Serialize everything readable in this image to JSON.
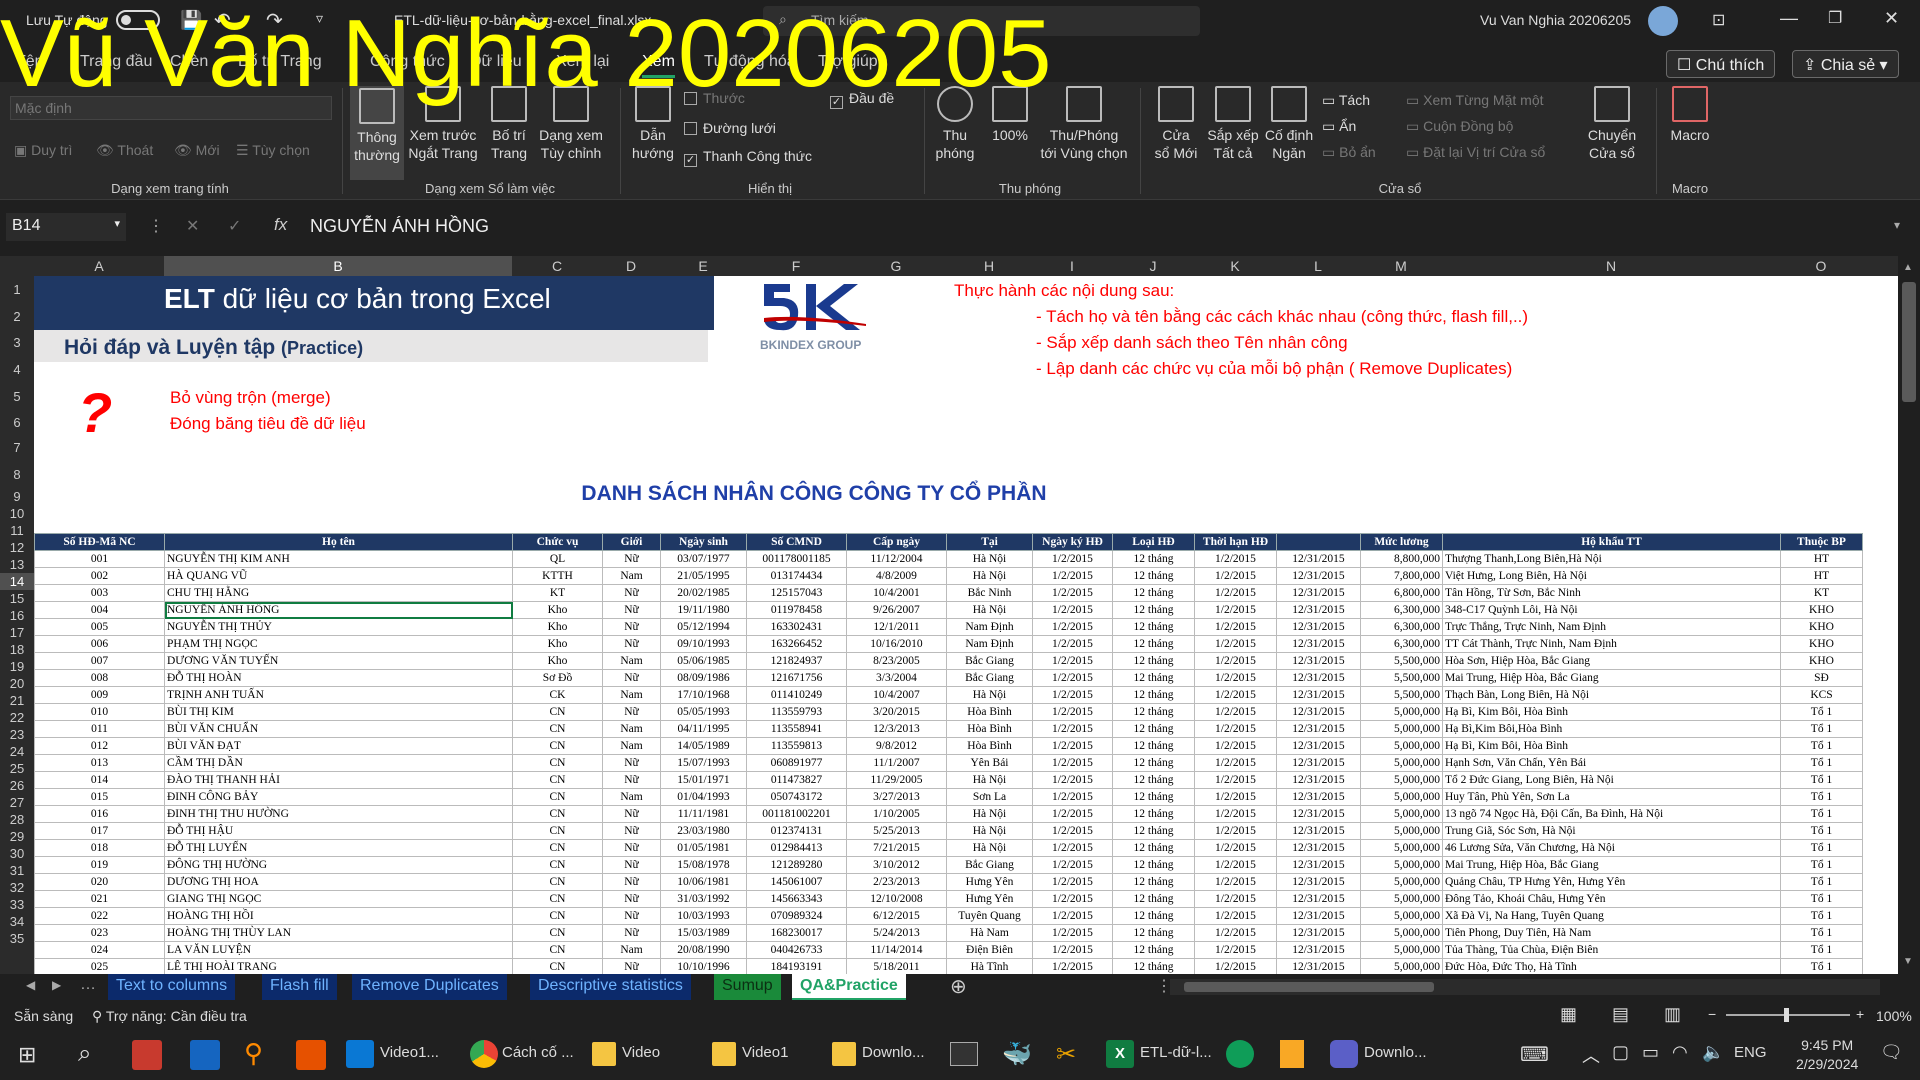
{
  "watermark": "Vũ Văn Nghĩa 20206205",
  "titlebar": {
    "autosave_label": "Lưu Tự động",
    "filename": "ETL-dữ-liệu-cơ-bản-bằng-excel_final.xlsx",
    "search_placeholder": "Tìm kiếm",
    "user": "Vu Van Nghia 20206205"
  },
  "tabs": [
    "Tệp",
    "Trang đầu",
    "Chèn",
    "Bố trí Trang",
    "Công thức",
    "Dữ liệu",
    "Xem lại",
    "Xem",
    "Tự động hóa",
    "Trợ giúp"
  ],
  "comment_btn": "Chú thích",
  "share_btn": "Chia sẻ",
  "ribbon": {
    "sheetview_select": "Mặc định",
    "sheetview_btns": [
      "Duy trì",
      "Thoát",
      "Mới",
      "Tùy chọn"
    ],
    "sheetview_label": "Dạng xem trang tính",
    "workbook_views": [
      {
        "l1": "Thông",
        "l2": "thường"
      },
      {
        "l1": "Xem trước",
        "l2": "Ngắt Trang"
      },
      {
        "l1": "Bố trí",
        "l2": "Trang"
      },
      {
        "l1": "Dạng xem",
        "l2": "Tùy chỉnh"
      }
    ],
    "workbook_label": "Dạng xem Sổ làm việc",
    "show_nav": {
      "l1": "Dẫn",
      "l2": "hướng"
    },
    "show_items": [
      {
        "label": "Thước",
        "checked": "",
        "enabled": false
      },
      {
        "label": "Đường lưới",
        "checked": "",
        "enabled": true
      },
      {
        "label": "Thanh Công thức",
        "checked": "✓",
        "enabled": true
      },
      {
        "label": "Đầu đề",
        "checked": "✓",
        "enabled": true
      }
    ],
    "show_label": "Hiển thị",
    "zoom_btns": [
      {
        "l1": "Thu",
        "l2": "phóng"
      },
      {
        "l1": "100%",
        "l2": ""
      },
      {
        "l1": "Thu/Phóng",
        "l2": "tới Vùng chọn"
      }
    ],
    "zoom_label": "Thu phóng",
    "window_btns": [
      {
        "l1": "Cửa",
        "l2": "sổ Mới"
      },
      {
        "l1": "Sắp xếp",
        "l2": "Tất cả"
      },
      {
        "l1": "Cố định",
        "l2": "Ngăn"
      }
    ],
    "window_small": [
      "Tách",
      "Ẩn",
      "Bỏ ẩn",
      "Xem Từng Mặt một",
      "Cuộn Đồng bộ",
      "Đặt lại Vị trí Cửa sổ"
    ],
    "switch_btn": {
      "l1": "Chuyển",
      "l2": "Cửa sổ"
    },
    "window_label": "Cửa sổ",
    "macro_btn": "Macro",
    "macro_label": "Macro"
  },
  "formula": {
    "namebox": "B14",
    "fx": "fx",
    "value": "NGUYỄN ÁNH HỒNG"
  },
  "columns": [
    "A",
    "B",
    "C",
    "D",
    "E",
    "F",
    "G",
    "H",
    "I",
    "J",
    "K",
    "L",
    "M",
    "N",
    "O"
  ],
  "rows": [
    "1",
    "2",
    "3",
    "4",
    "5",
    "6",
    "7",
    "8",
    "9",
    "10",
    "11",
    "12",
    "13",
    "14",
    "15",
    "16",
    "17",
    "18",
    "19",
    "20",
    "21",
    "22",
    "23",
    "24",
    "25",
    "26",
    "27",
    "28",
    "29",
    "30",
    "31",
    "32",
    "33",
    "34",
    "35"
  ],
  "sheet": {
    "banner_title_bold": "ELT",
    "banner_title_rest": " dữ liệu cơ bản trong Excel",
    "subtitle": "Hỏi đáp và Luyện tập",
    "subtitle_paren": "(Practice)",
    "logo_sub": "BKINDEX GROUP",
    "question": "?",
    "notes": [
      "Bỏ vùng trộn (merge)",
      "Đóng băng tiêu đề dữ liệu"
    ],
    "practice_title": "Thực hành các nội dung sau:",
    "practice_items": [
      "- Tách họ và tên bằng các cách khác nhau (công thức, flash fill,..)",
      "- Sắp xếp danh sách theo Tên nhân công",
      "- Lập danh các chức vụ của mỗi bộ phận ( Remove Duplicates)"
    ],
    "list_title": "DANH SÁCH NHÂN CÔNG CÔNG TY CỔ PHẦN",
    "headers": [
      "Số HĐ-Mã NC",
      "Họ tên",
      "Chức vụ",
      "Giới",
      "Ngày sinh",
      "Số CMND",
      "Cấp ngày",
      "Tại",
      "Ngày ký HĐ",
      "Loại HĐ",
      "Thời hạn HĐ",
      "",
      "Mức lương",
      "Hộ khẩu TT",
      "Thuộc BP"
    ],
    "records": [
      [
        "001",
        "NGUYỄN THỊ KIM ANH",
        "QL",
        "Nữ",
        "03/07/1977",
        "001178001185",
        "11/12/2004",
        "Hà Nội",
        "1/2/2015",
        "12 tháng",
        "1/2/2015",
        "12/31/2015",
        "8,800,000",
        "Thượng Thanh,Long Biên,Hà Nội",
        "HT"
      ],
      [
        "002",
        "HÀ QUANG VŨ",
        "KTTH",
        "Nam",
        "21/05/1995",
        "013174434",
        "4/8/2009",
        "Hà Nội",
        "1/2/2015",
        "12 tháng",
        "1/2/2015",
        "12/31/2015",
        "7,800,000",
        "Việt Hưng, Long Biên, Hà Nội",
        "HT"
      ],
      [
        "003",
        "CHU THỊ HẰNG",
        "KT",
        "Nữ",
        "20/02/1985",
        "125157043",
        "10/4/2001",
        "Bắc Ninh",
        "1/2/2015",
        "12 tháng",
        "1/2/2015",
        "12/31/2015",
        "6,800,000",
        "Tân Hồng, Từ Sơn, Bắc Ninh",
        "KT"
      ],
      [
        "004",
        "NGUYỄN ÁNH HỒNG",
        "Kho",
        "Nữ",
        "19/11/1980",
        "011978458",
        "9/26/2007",
        "Hà Nội",
        "1/2/2015",
        "12 tháng",
        "1/2/2015",
        "12/31/2015",
        "6,300,000",
        "348-C17 Quỳnh Lôi, Hà Nội",
        "KHO"
      ],
      [
        "005",
        "NGUYỄN THỊ THỦY",
        "Kho",
        "Nữ",
        "05/12/1994",
        "163302431",
        "12/1/2011",
        "Nam Định",
        "1/2/2015",
        "12 tháng",
        "1/2/2015",
        "12/31/2015",
        "6,300,000",
        "Trực Thắng, Trực Ninh, Nam Định",
        "KHO"
      ],
      [
        "006",
        "PHẠM THỊ NGỌC",
        "Kho",
        "Nữ",
        "09/10/1993",
        "163266452",
        "10/16/2010",
        "Nam Định",
        "1/2/2015",
        "12 tháng",
        "1/2/2015",
        "12/31/2015",
        "6,300,000",
        "TT Cát Thành, Trực Ninh, Nam Định",
        "KHO"
      ],
      [
        "007",
        "DƯƠNG VĂN TUYẾN",
        "Kho",
        "Nam",
        "05/06/1985",
        "121824937",
        "8/23/2005",
        "Bắc Giang",
        "1/2/2015",
        "12 tháng",
        "1/2/2015",
        "12/31/2015",
        "5,500,000",
        "Hòa Sơn, Hiệp Hòa, Bắc Giang",
        "KHO"
      ],
      [
        "008",
        "ĐỖ THỊ HOÀN",
        "Sơ Đồ",
        "Nữ",
        "08/09/1986",
        "121671756",
        "3/3/2004",
        "Bắc Giang",
        "1/2/2015",
        "12 tháng",
        "1/2/2015",
        "12/31/2015",
        "5,500,000",
        "Mai Trung, Hiệp Hòa, Bắc Giang",
        "SĐ"
      ],
      [
        "009",
        "TRỊNH ANH TUẤN",
        "CK",
        "Nam",
        "17/10/1968",
        "011410249",
        "10/4/2007",
        "Hà Nội",
        "1/2/2015",
        "12 tháng",
        "1/2/2015",
        "12/31/2015",
        "5,500,000",
        "Thạch Bàn, Long Biên, Hà Nội",
        "KCS"
      ],
      [
        "010",
        "BÙI THỊ KIM",
        "CN",
        "Nữ",
        "05/05/1993",
        "113559793",
        "3/20/2015",
        "Hòa Bình",
        "1/2/2015",
        "12 tháng",
        "1/2/2015",
        "12/31/2015",
        "5,000,000",
        "Hạ Bì, Kim Bôi, Hòa Bình",
        "Tổ 1"
      ],
      [
        "011",
        "BÙI VĂN CHUẨN",
        "CN",
        "Nam",
        "04/11/1995",
        "113558941",
        "12/3/2013",
        "Hòa Bình",
        "1/2/2015",
        "12 tháng",
        "1/2/2015",
        "12/31/2015",
        "5,000,000",
        "Hạ Bì,Kim Bôi,Hòa Bình",
        "Tổ 1"
      ],
      [
        "012",
        "BÙI VĂN ĐẠT",
        "CN",
        "Nam",
        "14/05/1989",
        "113559813",
        "9/8/2012",
        "Hòa Bình",
        "1/2/2015",
        "12 tháng",
        "1/2/2015",
        "12/31/2015",
        "5,000,000",
        "Hạ Bì, Kim Bôi, Hòa Bình",
        "Tổ 1"
      ],
      [
        "013",
        "CẦM THỊ DẦN",
        "CN",
        "Nữ",
        "15/07/1993",
        "060891977",
        "11/1/2007",
        "Yên Bái",
        "1/2/2015",
        "12 tháng",
        "1/2/2015",
        "12/31/2015",
        "5,000,000",
        "Hạnh Sơn, Văn Chấn, Yên Bái",
        "Tổ 1"
      ],
      [
        "014",
        "ĐÀO THỊ THANH HẢI",
        "CN",
        "Nữ",
        "15/01/1971",
        "011473827",
        "11/29/2005",
        "Hà Nội",
        "1/2/2015",
        "12 tháng",
        "1/2/2015",
        "12/31/2015",
        "5,000,000",
        "Tổ 2 Đức Giang, Long Biên, Hà Nội",
        "Tổ 1"
      ],
      [
        "015",
        "ĐINH CÔNG BẢY",
        "CN",
        "Nam",
        "01/04/1993",
        "050743172",
        "3/27/2013",
        "Sơn La",
        "1/2/2015",
        "12 tháng",
        "1/2/2015",
        "12/31/2015",
        "5,000,000",
        "Huy Tân, Phù Yên, Sơn La",
        "Tổ 1"
      ],
      [
        "016",
        "ĐINH THỊ THU HƯỜNG",
        "CN",
        "Nữ",
        "11/11/1981",
        "001181002201",
        "1/10/2005",
        "Hà Nội",
        "1/2/2015",
        "12 tháng",
        "1/2/2015",
        "12/31/2015",
        "5,000,000",
        "13 ngõ 74 Ngọc Hà, Đội Cấn, Ba Đình, Hà Nội",
        "Tổ 1"
      ],
      [
        "017",
        "ĐỖ THỊ HẬU",
        "CN",
        "Nữ",
        "23/03/1980",
        "012374131",
        "5/25/2013",
        "Hà Nội",
        "1/2/2015",
        "12 tháng",
        "1/2/2015",
        "12/31/2015",
        "5,000,000",
        "Trung Giã, Sóc Sơn, Hà Nội",
        "Tổ 1"
      ],
      [
        "018",
        "ĐỖ THỊ LUYẾN",
        "CN",
        "Nữ",
        "01/05/1981",
        "012984413",
        "7/21/2015",
        "Hà Nội",
        "1/2/2015",
        "12 tháng",
        "1/2/2015",
        "12/31/2015",
        "5,000,000",
        "46 Lương Sửa, Văn Chương, Hà Nội",
        "Tổ 1"
      ],
      [
        "019",
        "ĐÔNG THỊ HƯỜNG",
        "CN",
        "Nữ",
        "15/08/1978",
        "121289280",
        "3/10/2012",
        "Bắc Giang",
        "1/2/2015",
        "12 tháng",
        "1/2/2015",
        "12/31/2015",
        "5,000,000",
        "Mai Trung, Hiệp Hòa, Bắc Giang",
        "Tổ 1"
      ],
      [
        "020",
        "DƯƠNG THỊ HOA",
        "CN",
        "Nữ",
        "10/06/1981",
        "145061007",
        "2/23/2013",
        "Hưng Yên",
        "1/2/2015",
        "12 tháng",
        "1/2/2015",
        "12/31/2015",
        "5,000,000",
        "Quảng Châu, TP Hưng Yên, Hưng Yên",
        "Tổ 1"
      ],
      [
        "021",
        "GIANG THỊ NGỌC",
        "CN",
        "Nữ",
        "31/03/1992",
        "145663343",
        "12/10/2008",
        "Hưng Yên",
        "1/2/2015",
        "12 tháng",
        "1/2/2015",
        "12/31/2015",
        "5,000,000",
        "Đông Tảo, Khoái Châu, Hưng Yên",
        "Tổ 1"
      ],
      [
        "022",
        "HOÀNG THỊ HỒI",
        "CN",
        "Nữ",
        "10/03/1993",
        "070989324",
        "6/12/2015",
        "Tuyên Quang",
        "1/2/2015",
        "12 tháng",
        "1/2/2015",
        "12/31/2015",
        "5,000,000",
        "Xã Đà Vị, Na Hang, Tuyên Quang",
        "Tổ 1"
      ],
      [
        "023",
        "HOÀNG THỊ THÙY LAN",
        "CN",
        "Nữ",
        "15/03/1989",
        "168230017",
        "5/24/2013",
        "Hà Nam",
        "1/2/2015",
        "12 tháng",
        "1/2/2015",
        "12/31/2015",
        "5,000,000",
        "Tiên Phong, Duy Tiên, Hà Nam",
        "Tổ 1"
      ],
      [
        "024",
        "LA VĂN LUYỆN",
        "CN",
        "Nam",
        "20/08/1990",
        "040426733",
        "11/14/2014",
        "Điện Biên",
        "1/2/2015",
        "12 tháng",
        "1/2/2015",
        "12/31/2015",
        "5,000,000",
        "Tủa Thàng, Tủa Chùa, Điện Biên",
        "Tổ 1"
      ],
      [
        "025",
        "LÊ THỊ HOÀI TRANG",
        "CN",
        "Nữ",
        "10/10/1996",
        "184193191",
        "5/18/2011",
        "Hà Tĩnh",
        "1/2/2015",
        "12 tháng",
        "1/2/2015",
        "12/31/2015",
        "5,000,000",
        "Đức Hòa, Đức Thọ, Hà Tĩnh",
        "Tổ 1"
      ]
    ]
  },
  "sheet_tabs": [
    "Text to columns",
    "Flash fill",
    "Remove Duplicates",
    "Descriptive statistics",
    "Sumup",
    "QA&Practice"
  ],
  "status": {
    "ready": "Sẵn sàng",
    "accessibility": "Trợ năng: Cần điều tra",
    "zoom": "100%"
  },
  "taskbar": {
    "items": [
      "Video1...",
      "Cách cố ...",
      "Video",
      "Video1",
      "Downlo...",
      "ETL-dữ-l...",
      "Downlo..."
    ],
    "lang": "ENG",
    "time": "9:45 PM",
    "date": "2/29/2024"
  },
  "colors": {
    "accent": "#1f3864",
    "banner_blue": "#1f3864",
    "red": "#ff0000",
    "link_blue": "#2f5597",
    "watermark": "#ffff00"
  }
}
